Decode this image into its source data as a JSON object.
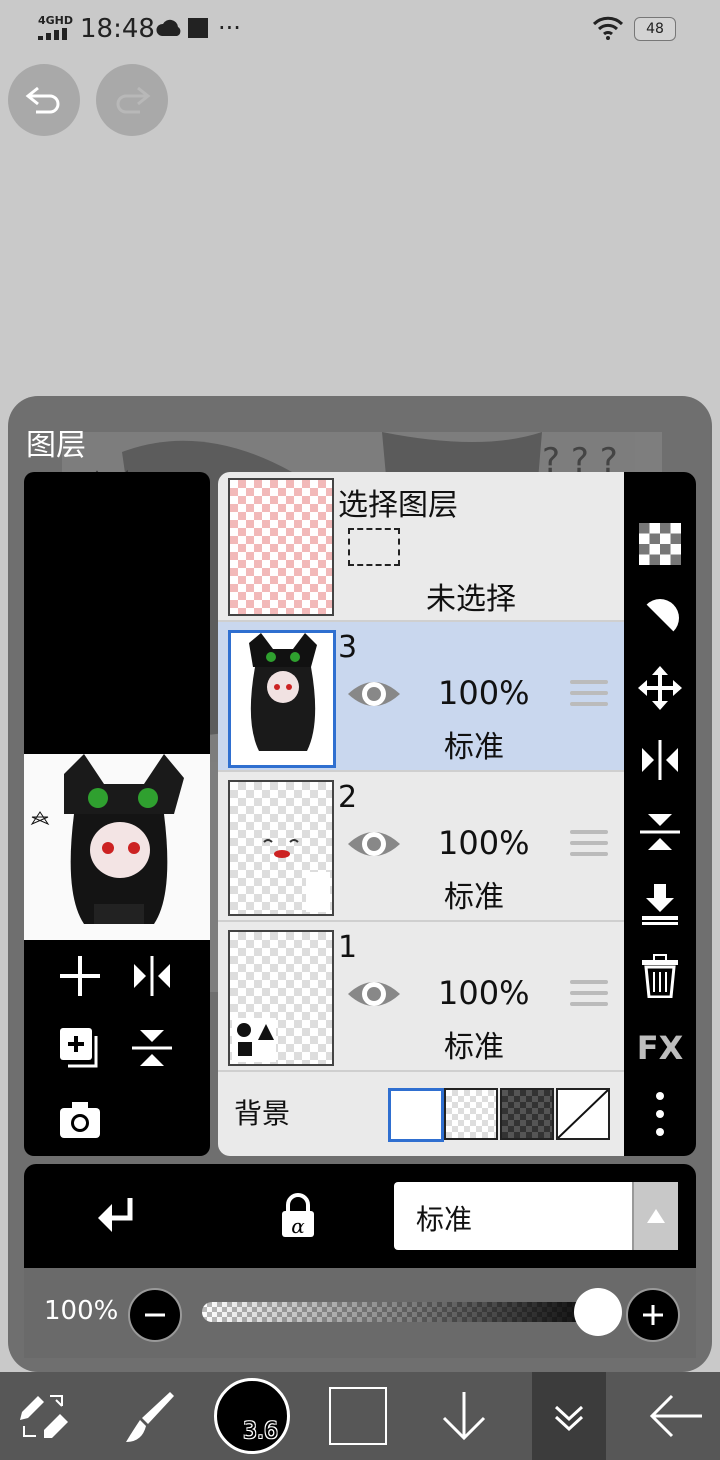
{
  "status_bar": {
    "network": "4GHD",
    "time": "18:48",
    "battery": "48",
    "more": "···"
  },
  "panel": {
    "title": "图层",
    "layers": [
      {
        "type": "selection",
        "title": "选择图层",
        "status": "未选择"
      },
      {
        "number": "3",
        "opacity": "100%",
        "blend": "标准",
        "selected": true
      },
      {
        "number": "2",
        "opacity": "100%",
        "blend": "标准",
        "selected": false
      },
      {
        "number": "1",
        "opacity": "100%",
        "blend": "标准",
        "selected": false
      }
    ],
    "background_label": "背景",
    "fx_label": "FX"
  },
  "blend_select": {
    "value": "标准"
  },
  "opacity": {
    "label": "100%",
    "value": 1.0
  },
  "brush": {
    "size": "3.6",
    "color": "#000000"
  },
  "colors": {
    "accent": "#2f6fd0",
    "selected_row": "#c9d7ee"
  }
}
